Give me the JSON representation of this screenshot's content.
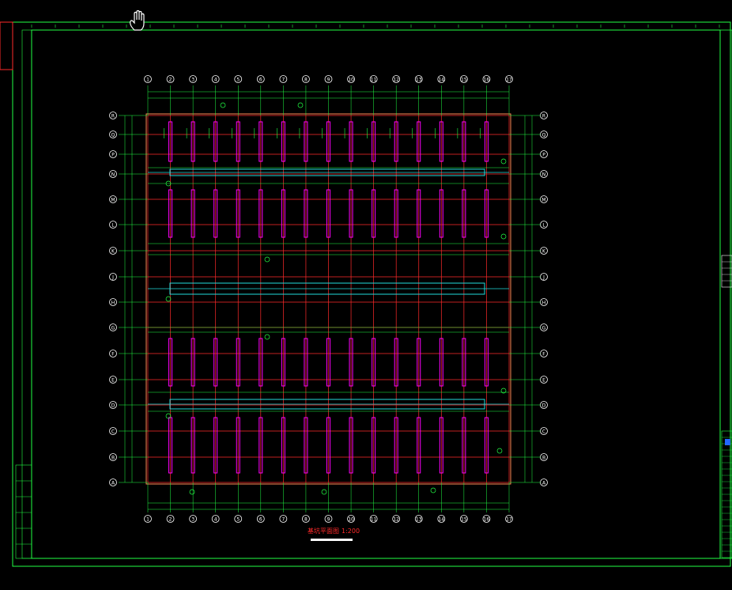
{
  "drawing": {
    "title": "基坑平面图",
    "scale": "1:200"
  },
  "axes": {
    "columns": [
      "1",
      "2",
      "3",
      "4",
      "5",
      "6",
      "7",
      "8",
      "9",
      "10",
      "11",
      "12",
      "13",
      "14",
      "15",
      "16",
      "17"
    ],
    "rows": [
      "R",
      "Q",
      "P",
      "N",
      "M",
      "L",
      "K",
      "J",
      "H",
      "G",
      "F",
      "E",
      "D",
      "C",
      "B",
      "A"
    ]
  },
  "colors": {
    "background": "#000000",
    "frame": "#22ff44",
    "grid": "#ff2a2a",
    "steel": "#ff00ff",
    "pipe": "#22dddd",
    "annotation": "#22ff44",
    "text": "#ffffff"
  },
  "icons": {
    "cursor": "hand-cursor-icon"
  }
}
